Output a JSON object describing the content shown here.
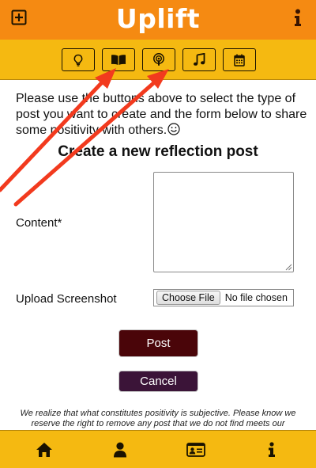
{
  "header": {
    "brand": "Uplift",
    "add_icon": "plus-square-icon",
    "info_icon": "info-icon",
    "color": "#f58a12"
  },
  "post_types": {
    "color": "#f5b911",
    "items": [
      {
        "name": "idea",
        "icon": "lightbulb-icon"
      },
      {
        "name": "reflection",
        "icon": "book-open-icon"
      },
      {
        "name": "podcast",
        "icon": "podcast-icon"
      },
      {
        "name": "music",
        "icon": "music-note-icon"
      },
      {
        "name": "event",
        "icon": "calendar-icon"
      }
    ]
  },
  "intro": {
    "text": "Please use the buttons above to select the type of post you want to create and the form below to share some positivity with others.",
    "emoji_icon": "smiley-icon"
  },
  "form": {
    "title": "Create a new reflection post",
    "content_label": "Content*",
    "content_value": "",
    "upload_label": "Upload Screenshot",
    "choose_file_label": "Choose File",
    "file_status": "No file chosen",
    "post_label": "Post",
    "cancel_label": "Cancel",
    "post_color": "#4a0509",
    "cancel_color": "#3b1438"
  },
  "disclaimer": "We realize that what constitutes positivity is subjective. Please know we reserve the right to remove any post that we do not find meets our",
  "bottom_nav": {
    "items": [
      {
        "name": "home",
        "icon": "home-icon"
      },
      {
        "name": "profile",
        "icon": "user-icon"
      },
      {
        "name": "contact-card",
        "icon": "id-card-icon"
      },
      {
        "name": "about",
        "icon": "info-icon"
      }
    ]
  },
  "annotation": {
    "arrow_color": "#f23a1e"
  }
}
